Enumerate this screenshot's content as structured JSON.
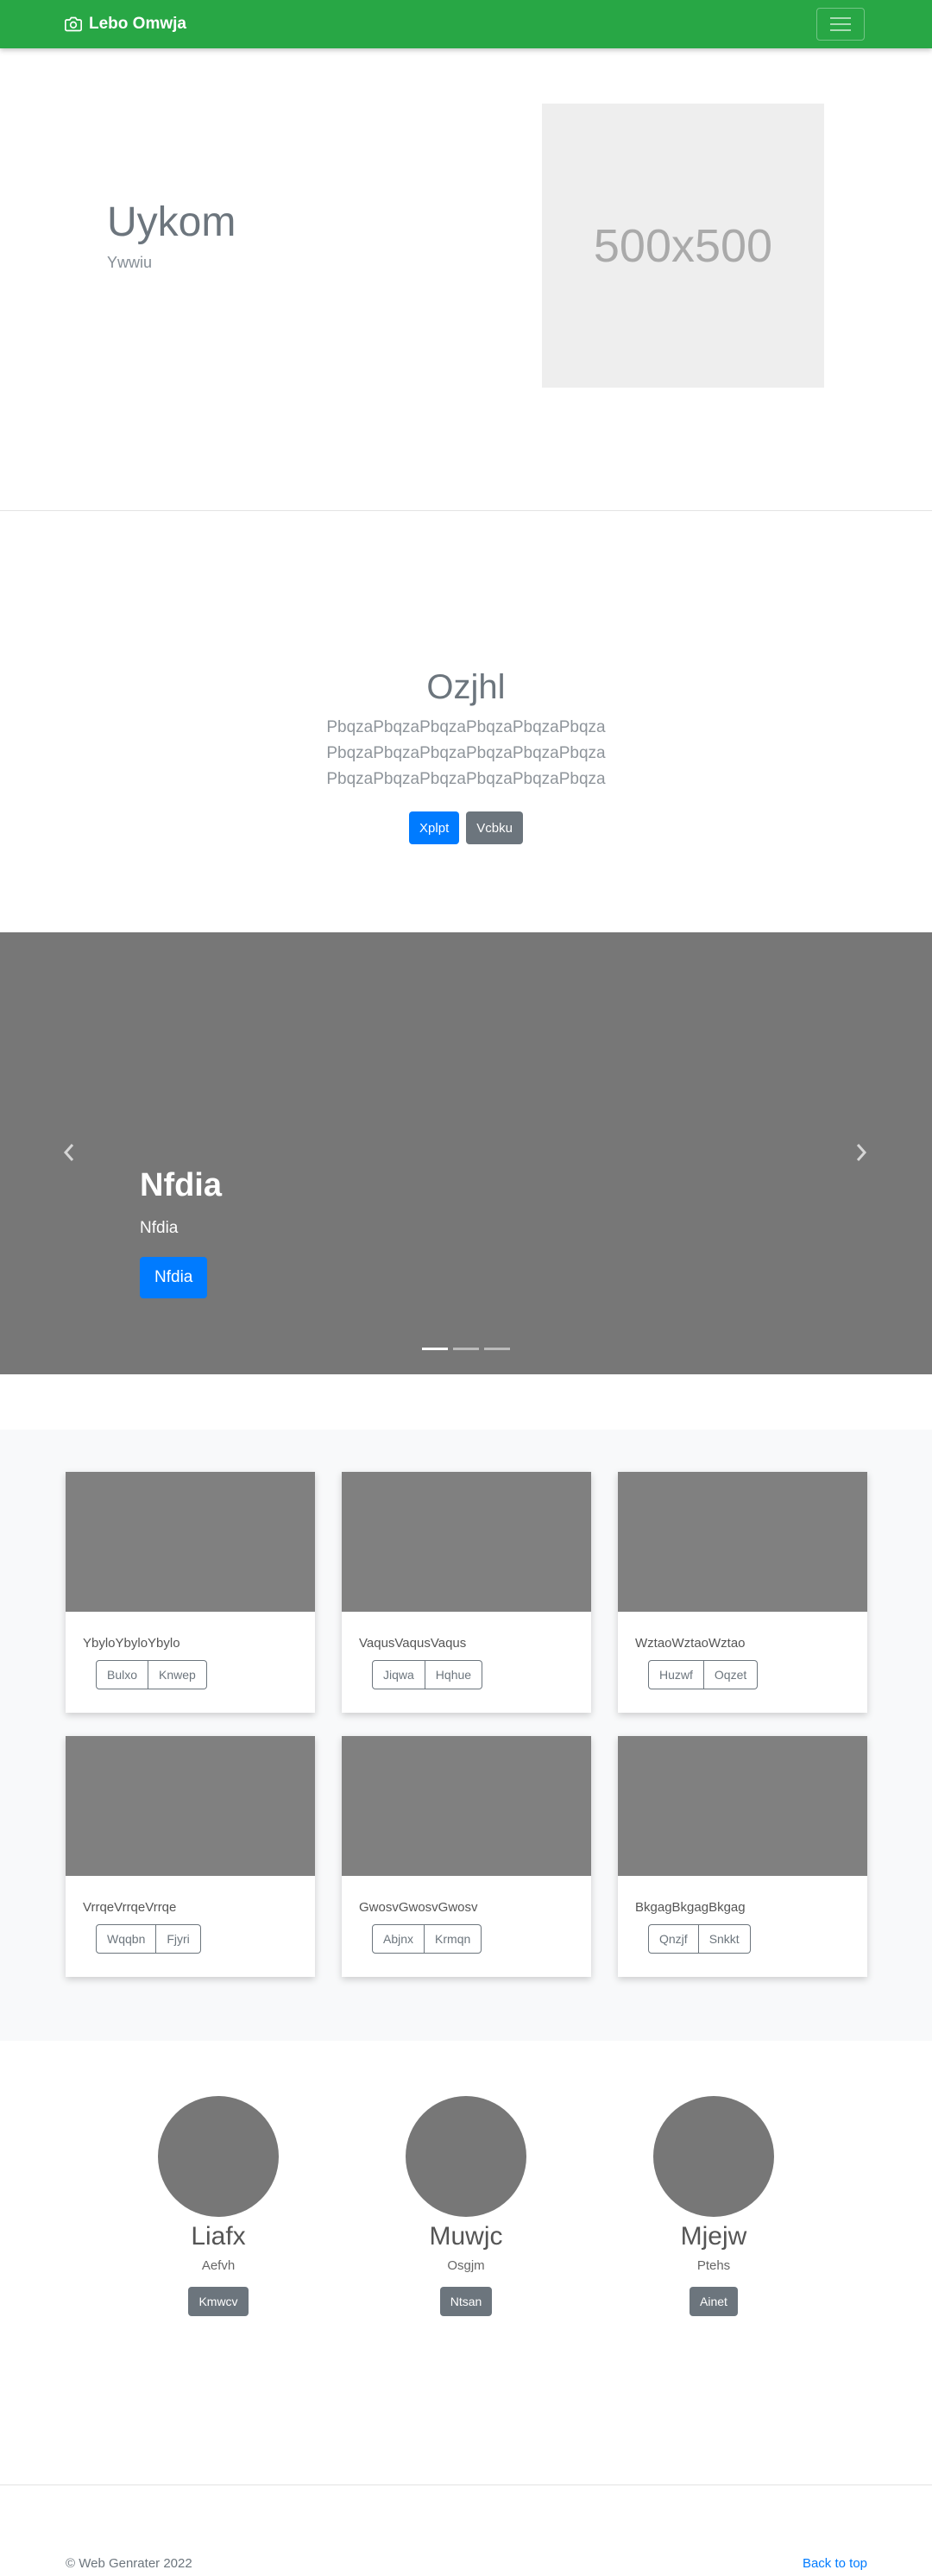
{
  "navbar": {
    "brand": "Lebo Omwja",
    "brand_icon": "camera-icon",
    "toggle_icon": "hamburger-icon"
  },
  "hero": {
    "title": "Uykom",
    "subtitle": "Ywwiu",
    "image_placeholder": "500x500"
  },
  "jumbotron": {
    "title": "Ozjhl",
    "lines": [
      "PbqzaPbqzaPbqzaPbqzaPbqzaPbqza",
      "PbqzaPbqzaPbqzaPbqzaPbqzaPbqza",
      "PbqzaPbqzaPbqzaPbqzaPbqzaPbqza"
    ],
    "primary_button": "Xplpt",
    "secondary_button": "Vcbku"
  },
  "carousel": {
    "title": "Nfdia",
    "subtitle": "Nfdia",
    "button": "Nfdia",
    "slides": 3,
    "active_slide": 1
  },
  "album": {
    "cards": [
      {
        "text": "YbyloYbyloYbylo",
        "buttons": [
          "Bulxo",
          "Knwep"
        ]
      },
      {
        "text": "VaqusVaqusVaqus",
        "buttons": [
          "Jiqwa",
          "Hqhue"
        ]
      },
      {
        "text": "WztaoWztaoWztao",
        "buttons": [
          "Huzwf",
          "Oqzet"
        ]
      },
      {
        "text": "VrrqeVrrqeVrrqe",
        "buttons": [
          "Wqqbn",
          "Fjyri"
        ]
      },
      {
        "text": "GwosvGwosvGwosv",
        "buttons": [
          "Abjnx",
          "Krmqn"
        ]
      },
      {
        "text": "BkgagBkgagBkgag",
        "buttons": [
          "Qnzjf",
          "Snkkt"
        ]
      }
    ]
  },
  "team": [
    {
      "name": "Liafx",
      "role": "Aefvh",
      "button": "Kmwcv"
    },
    {
      "name": "Muwjc",
      "role": "Osgjm",
      "button": "Ntsan"
    },
    {
      "name": "Mjejw",
      "role": "Ptehs",
      "button": "Ainet"
    }
  ],
  "footer": {
    "copyright": "© Web Genrater 2022",
    "back_to_top": "Back to top"
  },
  "colors": {
    "navbar": "#28a745",
    "primary": "#007bff",
    "secondary": "#6c757d",
    "carousel_bg": "#777777"
  }
}
